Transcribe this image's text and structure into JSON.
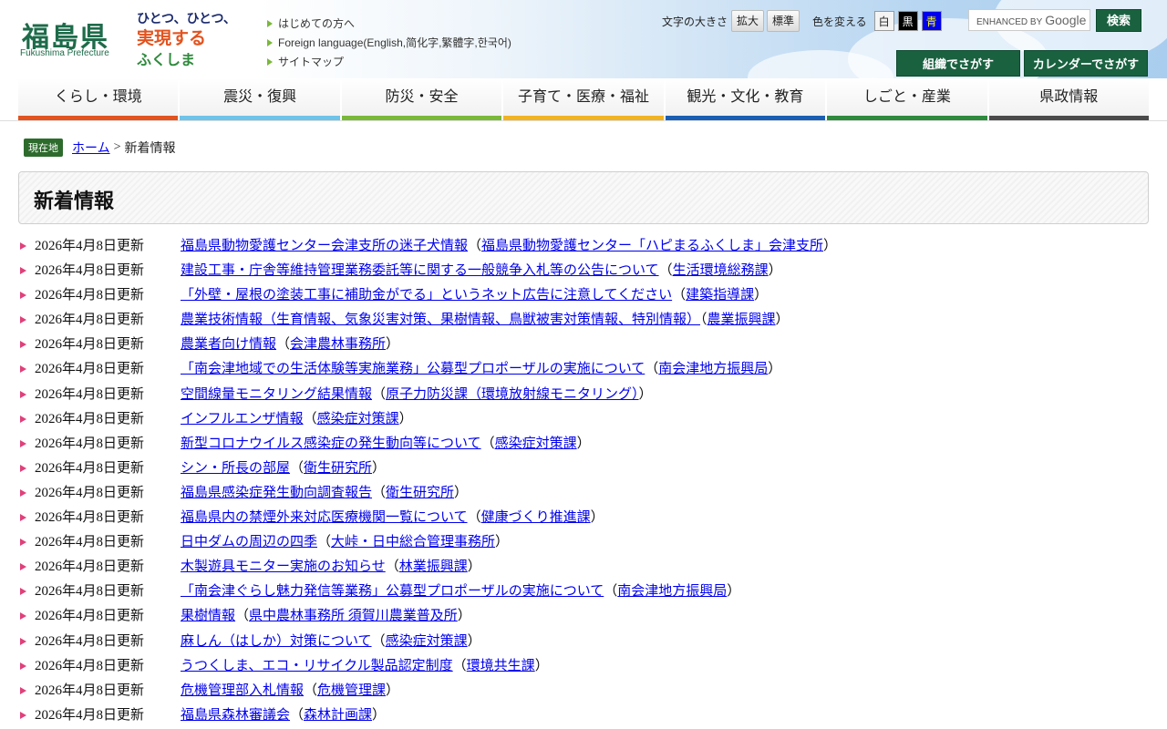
{
  "header": {
    "logo_text": "福島県",
    "logo_sub": "Fukushima Prefecture",
    "slogan_lines": [
      "ひとつ、ひとつ、",
      "実現する",
      "ふくしま"
    ],
    "links": [
      "はじめての方へ",
      "Foreign language(English,简化字,繁體字,한국어)",
      "サイトマップ"
    ],
    "font_size_label": "文字の大きさ",
    "font_enlarge": "拡大",
    "font_standard": "標準",
    "color_label": "色を変える",
    "color_white": "白",
    "color_black": "黒",
    "color_blue": "青",
    "search_placeholder": "ENHANCED BY",
    "search_google": "Google",
    "search_button": "検索",
    "org_search": "組織でさがす",
    "calendar_search": "カレンダーでさがす"
  },
  "nav": [
    {
      "label": "くらし・環境",
      "color": "#e2531f"
    },
    {
      "label": "震災・復興",
      "color": "#6ec3e8"
    },
    {
      "label": "防災・安全",
      "color": "#7ab83a"
    },
    {
      "label": "子育て・医療・福祉",
      "color": "#f0b323"
    },
    {
      "label": "観光・文化・教育",
      "color": "#1a5fb4"
    },
    {
      "label": "しごと・産業",
      "color": "#2e8a3c"
    },
    {
      "label": "県政情報",
      "color": "#4a4a4a"
    }
  ],
  "breadcrumb": {
    "badge": "現在地",
    "home": "ホーム",
    "separator": ">",
    "current": "新着情報"
  },
  "page_title": "新着情報",
  "news": [
    {
      "date": "2026年4月8日更新",
      "title": "福島県動物愛護センター会津支所の迷子犬情報",
      "dept": "福島県動物愛護センター「ハピまるふくしま」会津支所"
    },
    {
      "date": "2026年4月8日更新",
      "title": "建設工事・庁舎等維持管理業務委託等に関する一般競争入札等の公告について",
      "dept": "生活環境総務課"
    },
    {
      "date": "2026年4月8日更新",
      "title": "「外壁・屋根の塗装工事に補助金がでる」というネット広告に注意してください",
      "dept": "建築指導課"
    },
    {
      "date": "2026年4月8日更新",
      "title": "農業技術情報（生育情報、気象災害対策、果樹情報、鳥獣被害対策情報、特別情報）",
      "dept": "農業振興課"
    },
    {
      "date": "2026年4月8日更新",
      "title": "農業者向け情報",
      "dept": "会津農林事務所"
    },
    {
      "date": "2026年4月8日更新",
      "title": "「南会津地域での生活体験等実施業務」公募型プロポーザルの実施について",
      "dept": "南会津地方振興局"
    },
    {
      "date": "2026年4月8日更新",
      "title": "空間線量モニタリング結果情報",
      "dept": "原子力防災課（環境放射線モニタリング）"
    },
    {
      "date": "2026年4月8日更新",
      "title": "インフルエンザ情報",
      "dept": "感染症対策課"
    },
    {
      "date": "2026年4月8日更新",
      "title": "新型コロナウイルス感染症の発生動向等について",
      "dept": "感染症対策課"
    },
    {
      "date": "2026年4月8日更新",
      "title": "シン・所長の部屋",
      "dept": "衛生研究所"
    },
    {
      "date": "2026年4月8日更新",
      "title": "福島県感染症発生動向調査報告",
      "dept": "衛生研究所"
    },
    {
      "date": "2026年4月8日更新",
      "title": "福島県内の禁煙外来対応医療機関一覧について",
      "dept": "健康づくり推進課"
    },
    {
      "date": "2026年4月8日更新",
      "title": "日中ダムの周辺の四季",
      "dept": "大峠・日中総合管理事務所"
    },
    {
      "date": "2026年4月8日更新",
      "title": "木製遊具モニター実施のお知らせ",
      "dept": "林業振興課"
    },
    {
      "date": "2026年4月8日更新",
      "title": "「南会津ぐらし魅力発信等業務」公募型プロポーザルの実施について",
      "dept": "南会津地方振興局"
    },
    {
      "date": "2026年4月8日更新",
      "title": "果樹情報",
      "dept": "県中農林事務所 須賀川農業普及所"
    },
    {
      "date": "2026年4月8日更新",
      "title": "麻しん（はしか）対策について",
      "dept": "感染症対策課"
    },
    {
      "date": "2026年4月8日更新",
      "title": "うつくしま、エコ・リサイクル製品認定制度",
      "dept": "環境共生課"
    },
    {
      "date": "2026年4月8日更新",
      "title": "危機管理部入札情報",
      "dept": "危機管理課"
    },
    {
      "date": "2026年4月8日更新",
      "title": "福島県森林審議会",
      "dept": "森林計画課"
    }
  ]
}
